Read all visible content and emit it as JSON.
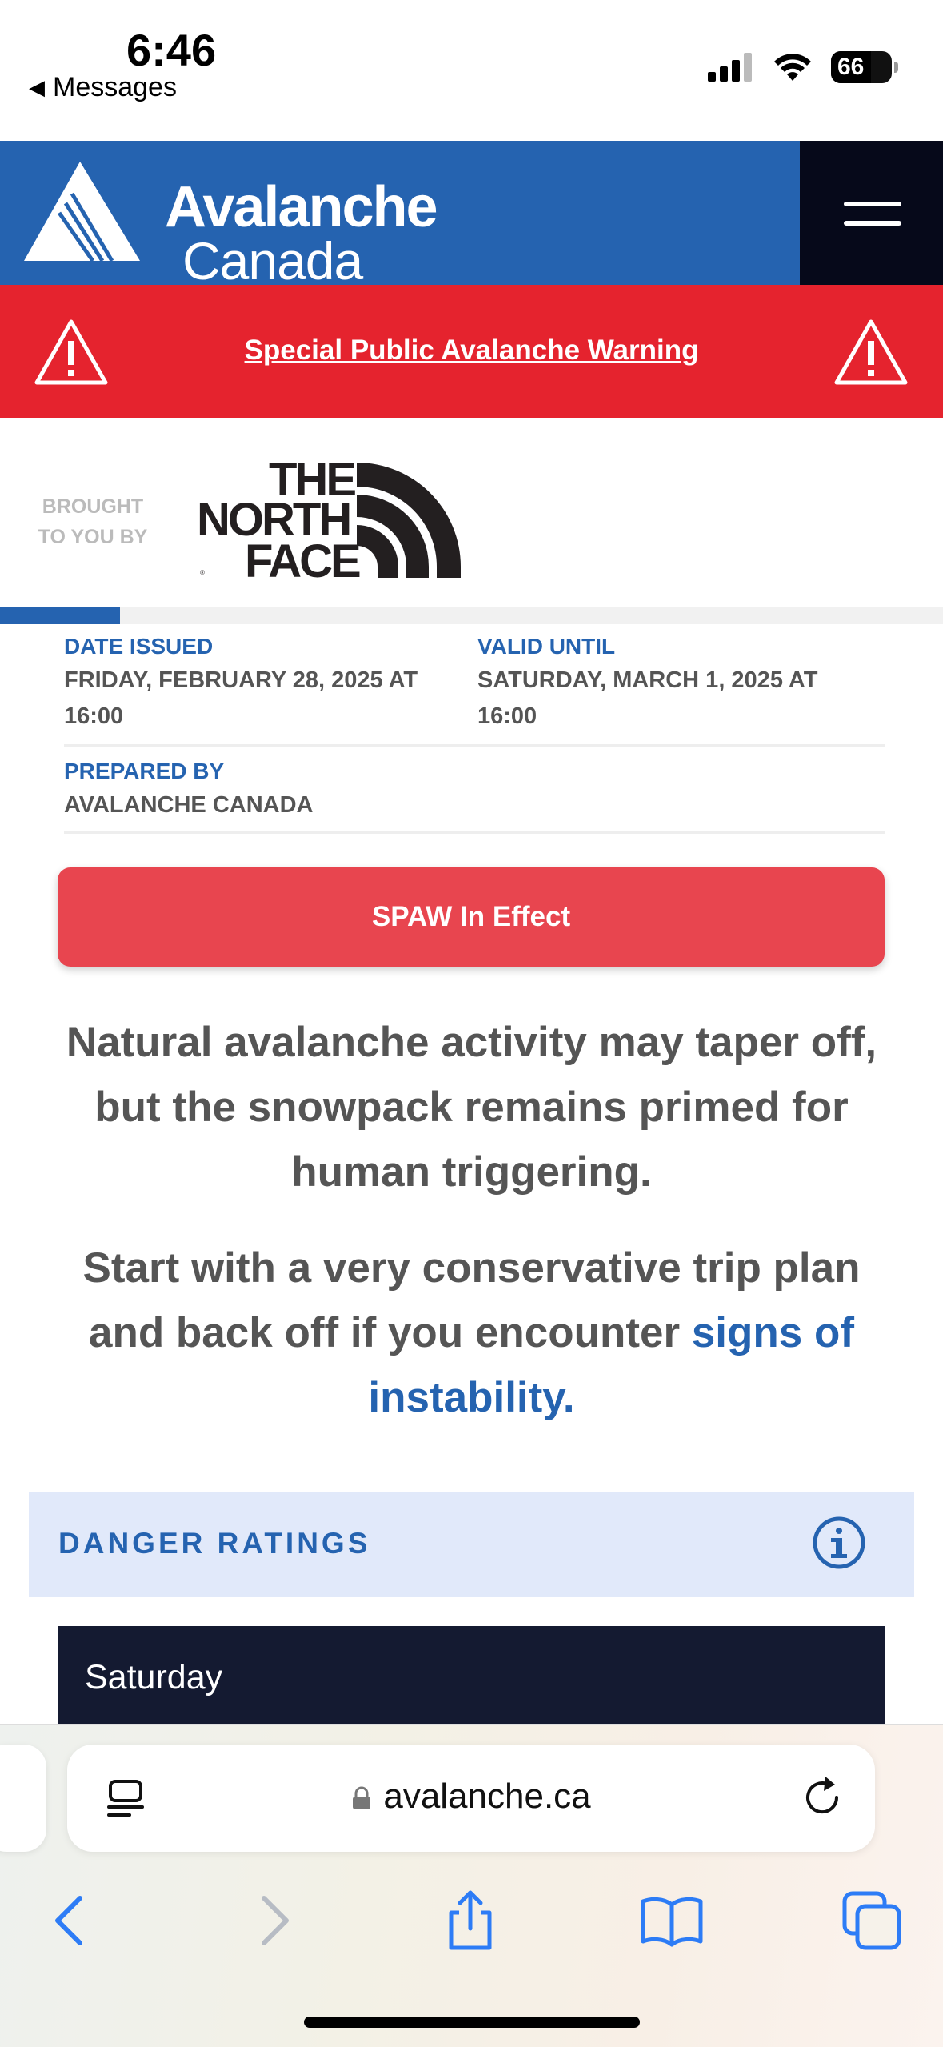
{
  "status_bar": {
    "time": "6:46",
    "back_app": "Messages",
    "battery": "66",
    "battery_level": 0.66
  },
  "header": {
    "logo_line1": "Avalanche",
    "logo_line2": "Canada"
  },
  "warning_banner": {
    "text": "Special Public Avalanche Warning"
  },
  "sponsor": {
    "brought_by": "BROUGHT TO YOU BY",
    "brand_line1": "THE",
    "brand_line2": "NORTH",
    "brand_line3": "FACE"
  },
  "progress": {
    "fraction": 0.127
  },
  "details": {
    "date_issued_label": "DATE ISSUED",
    "date_issued_value": "FRIDAY, FEBRUARY 28, 2025 AT 16:00",
    "valid_until_label": "VALID UNTIL",
    "valid_until_value": "SATURDAY, MARCH 1, 2025 AT 16:00",
    "prepared_by_label": "PREPARED BY",
    "prepared_by_value": "AVALANCHE CANADA"
  },
  "spaw_button": {
    "label": "SPAW In Effect"
  },
  "headline1": "Natural avalanche activity may taper off, but the snowpack remains primed for human triggering.",
  "headline2": {
    "text": "Start with a very conservative trip plan and back off if you encounter ",
    "link": "signs of instability."
  },
  "danger_ratings": {
    "title": "DANGER RATINGS"
  },
  "day_card": {
    "label": "Saturday"
  },
  "browser": {
    "url": "avalanche.ca"
  },
  "colors": {
    "brand_blue": "#2563b0",
    "warning_red": "#e5232e",
    "spaw_red": "#e8454f",
    "dark_navy": "#141a31"
  }
}
